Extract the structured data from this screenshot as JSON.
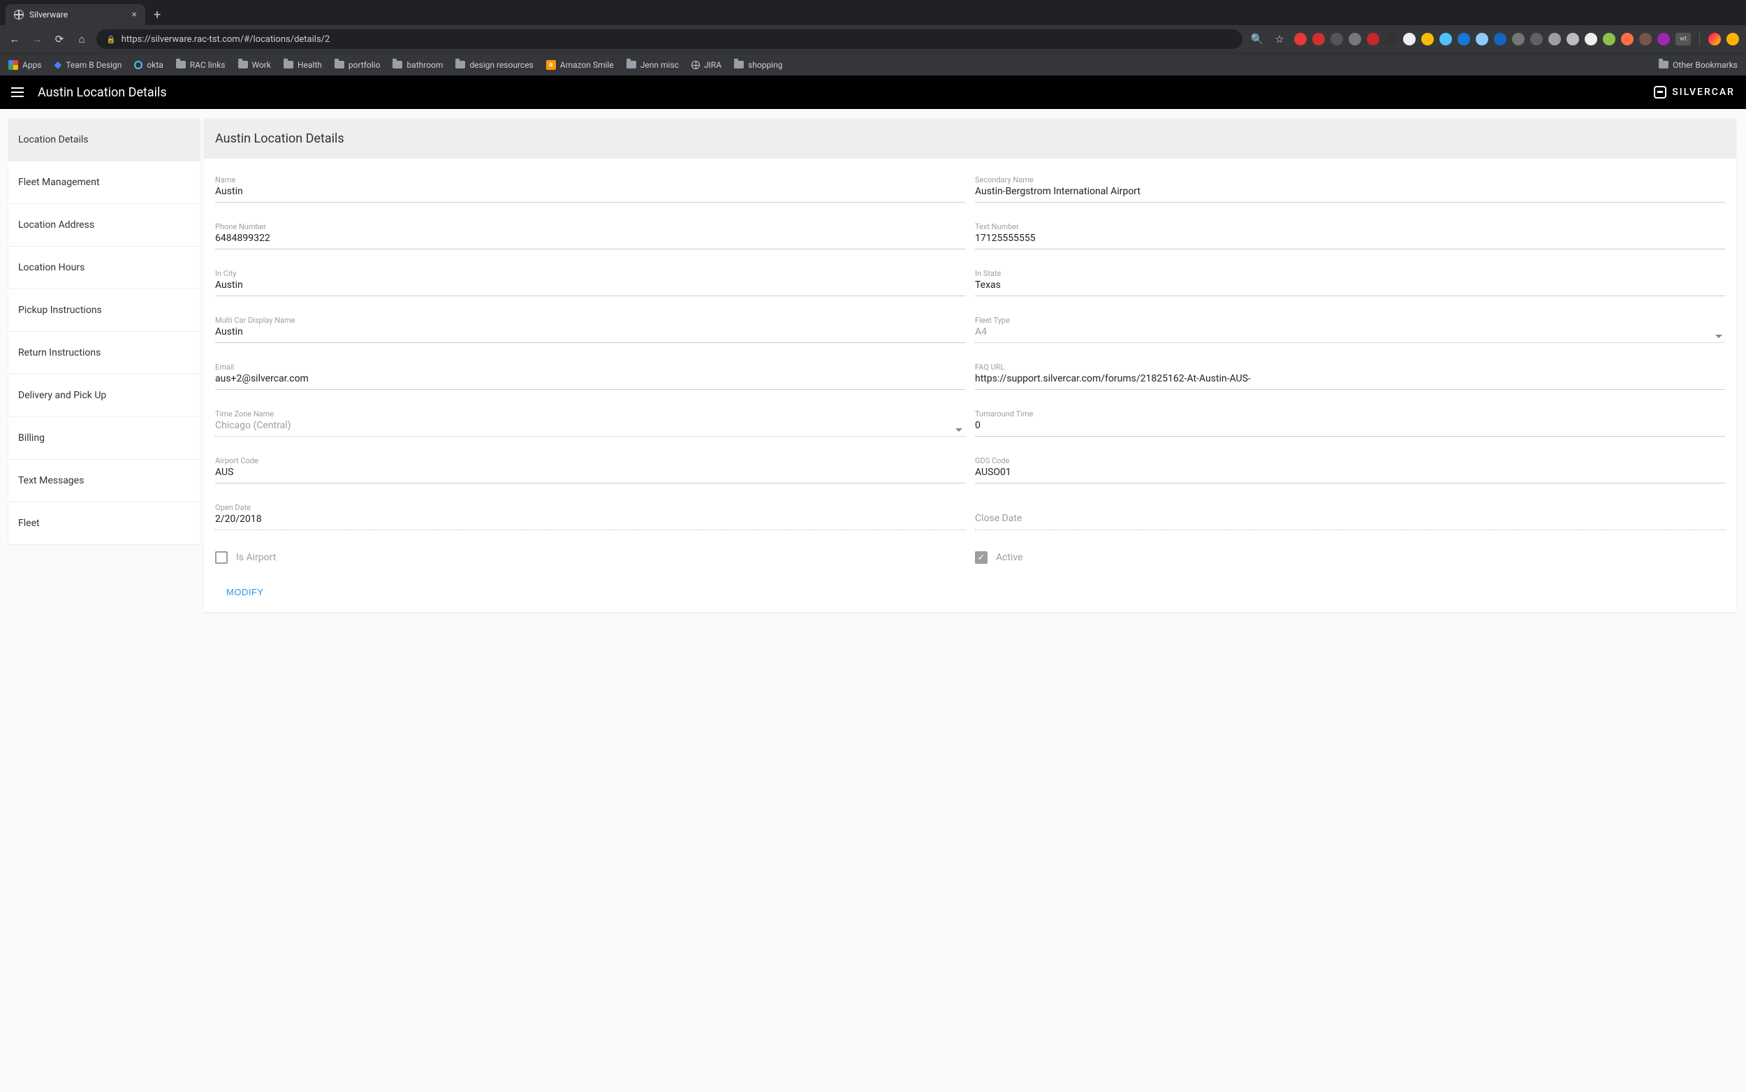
{
  "browser": {
    "tab_title": "Silverware",
    "url": "https://silverware.rac-tst.com/#/locations/details/2",
    "bookmarks": {
      "apps": "Apps",
      "team_b": "Team B Design",
      "okta": "okta",
      "rac_links": "RAC links",
      "work": "Work",
      "health": "Health",
      "portfolio": "portfolio",
      "bathroom": "bathroom",
      "design_resources": "design resources",
      "amazon": "Amazon Smile",
      "jenn": "Jenn misc",
      "jira": "JIRA",
      "shopping": "shopping",
      "other": "Other Bookmarks"
    }
  },
  "header": {
    "title": "Austin Location Details",
    "brand": "SILVERCAR"
  },
  "sidebar": {
    "items": [
      "Location Details",
      "Fleet Management",
      "Location Address",
      "Location Hours",
      "Pickup Instructions",
      "Return Instructions",
      "Delivery and Pick Up",
      "Billing",
      "Text Messages",
      "Fleet"
    ]
  },
  "content": {
    "heading": "Austin Location Details",
    "fields": {
      "name": {
        "label": "Name",
        "value": "Austin"
      },
      "secondary_name": {
        "label": "Secondary Name",
        "value": "Austin-Bergstrom International Airport"
      },
      "phone": {
        "label": "Phone Number",
        "value": "6484899322"
      },
      "text_number": {
        "label": "Text Number",
        "value": "17125555555"
      },
      "in_city": {
        "label": "In City",
        "value": "Austin"
      },
      "in_state": {
        "label": "In State",
        "value": "Texas"
      },
      "multi_car": {
        "label": "Multi Car Display Name",
        "value": "Austin"
      },
      "fleet_type": {
        "label": "Fleet Type",
        "value": "A4"
      },
      "email": {
        "label": "Email",
        "value": "aus+2@silvercar.com"
      },
      "faq_url": {
        "label": "FAQ URL",
        "value": "https://support.silvercar.com/forums/21825162-At-Austin-AUS-"
      },
      "tz": {
        "label": "Time Zone Name",
        "value": "Chicago (Central)"
      },
      "turnaround": {
        "label": "Turnaround Time",
        "value": "0"
      },
      "airport_code": {
        "label": "Airport Code",
        "value": "AUS"
      },
      "gds_code": {
        "label": "GDS Code",
        "value": "AUSO01"
      },
      "open_date": {
        "label": "Open Date",
        "value": "2/20/2018"
      },
      "close_date": {
        "label": "Close Date",
        "value": ""
      }
    },
    "checkboxes": {
      "is_airport": {
        "label": "Is Airport",
        "checked": false
      },
      "active": {
        "label": "Active",
        "checked": true
      }
    },
    "modify_label": "MODIFY"
  }
}
